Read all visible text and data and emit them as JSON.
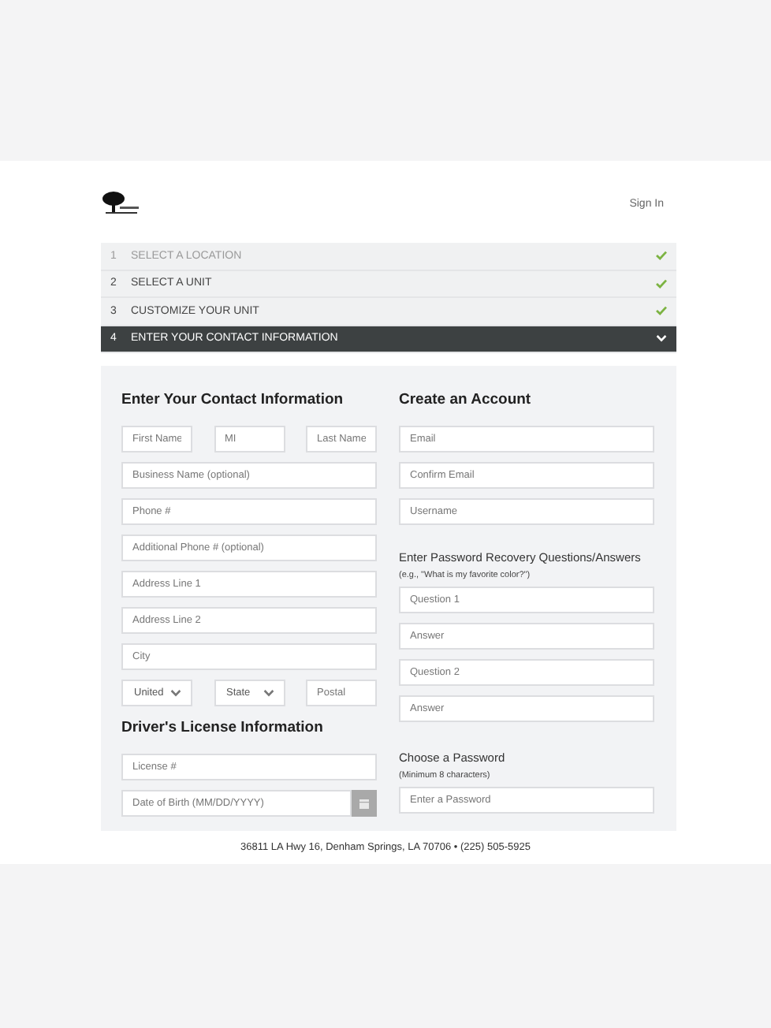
{
  "header": {
    "sign_in": "Sign In"
  },
  "steps": [
    {
      "number": "1",
      "label": "SELECT A LOCATION",
      "completed": true,
      "selected": false
    },
    {
      "number": "2",
      "label": "SELECT A UNIT",
      "completed": true,
      "selected": false
    },
    {
      "number": "3",
      "label": "CUSTOMIZE YOUR UNIT",
      "completed": true,
      "selected": false
    },
    {
      "number": "4",
      "label": "ENTER YOUR CONTACT INFORMATION",
      "completed": false,
      "selected": true
    }
  ],
  "contact": {
    "title": "Enter Your Contact Information",
    "name_fields": [
      {
        "placeholder": "First Name"
      },
      {
        "placeholder": "MI"
      },
      {
        "placeholder": "Last Name"
      }
    ],
    "fields": [
      {
        "placeholder": "Business Name (optional)"
      },
      {
        "placeholder": "Phone #"
      },
      {
        "placeholder": "Additional Phone # (optional)"
      },
      {
        "placeholder": "Address Line 1"
      },
      {
        "placeholder": "Address Line 2"
      },
      {
        "placeholder": "City"
      }
    ],
    "region_row": [
      {
        "kind": "select",
        "value": "United"
      },
      {
        "kind": "select",
        "value": "State"
      },
      {
        "kind": "input",
        "placeholder": "Postal"
      }
    ]
  },
  "license": {
    "title": "Driver's License Information",
    "fields": [
      {
        "kind": "input",
        "placeholder": "License #"
      },
      {
        "kind": "date",
        "placeholder": "Date of Birth (MM/DD/YYYY)"
      }
    ]
  },
  "account": {
    "title": "Create an Account",
    "fields": [
      {
        "placeholder": "Email"
      },
      {
        "placeholder": "Confirm Email"
      },
      {
        "placeholder": "Username"
      }
    ],
    "recovery": {
      "title": "Enter Password Recovery Questions/Answers",
      "hint": "(e.g., \"What is my favorite color?\")",
      "fields": [
        {
          "placeholder": "Question 1"
        },
        {
          "placeholder": "Answer"
        },
        {
          "placeholder": "Question 2"
        },
        {
          "placeholder": "Answer"
        }
      ]
    },
    "password": {
      "title": "Choose a Password",
      "hint": "(Minimum 8 characters)",
      "fields": [
        {
          "placeholder": "Enter a Password"
        }
      ]
    }
  },
  "footer": {
    "address": "36811 LA Hwy 16, Denham Springs, LA 70706 • (225) 505-5925"
  }
}
